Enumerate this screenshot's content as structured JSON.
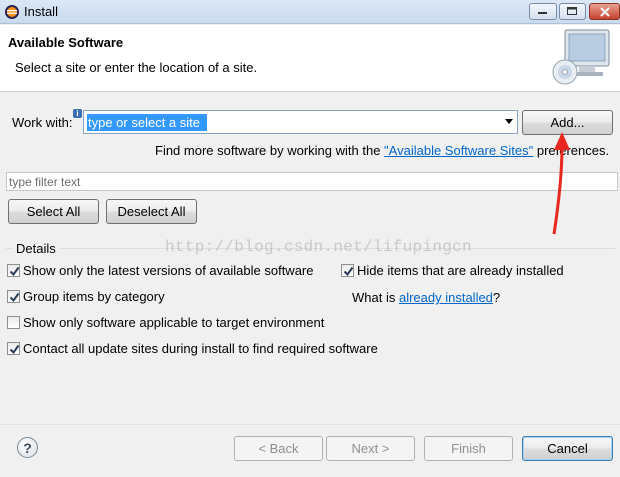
{
  "window": {
    "title": "Install",
    "icons": {
      "app": "eclipse-icon",
      "minimize": "minimize-icon",
      "maximize": "maximize-icon",
      "close": "close-icon"
    }
  },
  "header": {
    "title": "Available Software",
    "description": "Select a site or enter the location of a site.",
    "image": "monitor-cd-icon"
  },
  "work_with": {
    "label": "Work with:",
    "placeholder": "type or select a site",
    "add_label": "Add...",
    "find_more_prefix": "Find more software by working with the ",
    "find_more_link": "\"Available Software Sites\"",
    "find_more_suffix": " preferences."
  },
  "filter": {
    "placeholder": "type filter text"
  },
  "selection": {
    "select_all": "Select All",
    "deselect_all": "Deselect All"
  },
  "details": {
    "label": "Details",
    "options": [
      {
        "label": "Show only the latest versions of available software",
        "checked": true
      },
      {
        "label": "Hide items that are already installed",
        "checked": true
      },
      {
        "label": "Group items by category",
        "checked": true
      },
      {
        "label": "Show only software applicable to target environment",
        "checked": false
      },
      {
        "label": "Contact all update sites during install to find required software",
        "checked": true
      }
    ],
    "what_is_prefix": "What is ",
    "what_is_link": "already installed",
    "what_is_suffix": "?"
  },
  "watermark": "http://blog.csdn.net/lifupingcn",
  "footer": {
    "help": "?",
    "back": "< Back",
    "next": "Next >",
    "finish": "Finish",
    "cancel": "Cancel"
  },
  "colors": {
    "accent": "#3399ff",
    "link": "#0066cc",
    "annotation": "#e8281e"
  }
}
